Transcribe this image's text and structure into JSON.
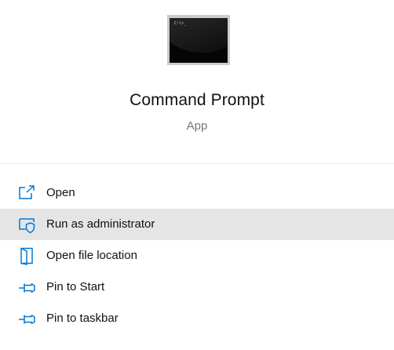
{
  "app": {
    "title": "Command Prompt",
    "type": "App",
    "icon_prompt_text": "C:\\>_"
  },
  "menu": {
    "items": [
      {
        "label": "Open",
        "icon": "open-icon"
      },
      {
        "label": "Run as administrator",
        "icon": "shield-icon"
      },
      {
        "label": "Open file location",
        "icon": "file-location-icon"
      },
      {
        "label": "Pin to Start",
        "icon": "pin-icon"
      },
      {
        "label": "Pin to taskbar",
        "icon": "pin-icon"
      }
    ],
    "hovered_label": "Run as administrator"
  },
  "colors": {
    "accent": "#0078d7",
    "hover_background": "#e5e5e5",
    "subtitle_text": "#767676"
  }
}
